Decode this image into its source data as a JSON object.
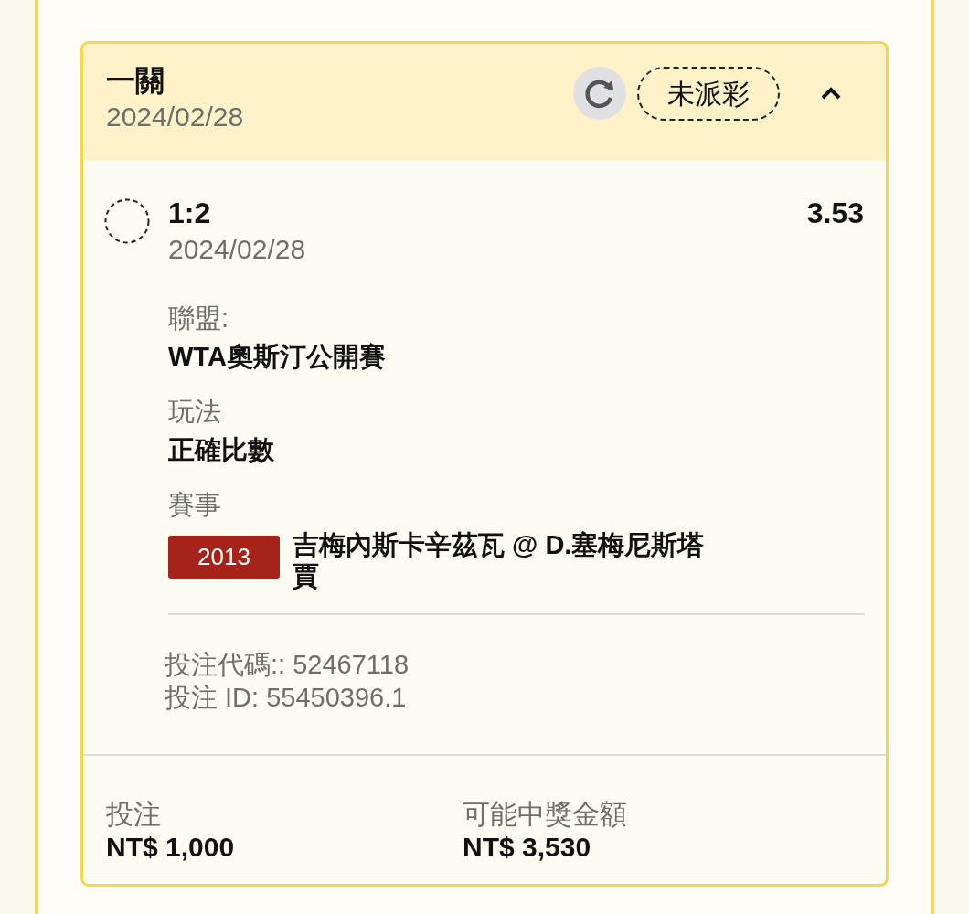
{
  "bet_card": {
    "title": "一關",
    "date": "2024/02/28",
    "status": "未派彩",
    "expanded": true,
    "selection": {
      "pick": "1:2",
      "date": "2024/02/28",
      "odds": "3.53",
      "details": [
        {
          "label": "聯盟:",
          "value": "WTA奧斯汀公開賽"
        },
        {
          "label": "玩法",
          "value": "正確比數"
        },
        {
          "label": "賽事",
          "tag": "2013",
          "value": "吉梅內斯卡辛茲瓦 @ D.塞梅尼斯塔賈"
        }
      ]
    },
    "bet_code": "投注代碼:: 52467118",
    "bet_id": "投注 ID: 55450396.1",
    "totals": [
      {
        "label": "投注",
        "value": "NT$ 1,000"
      },
      {
        "label": "可能中獎金額",
        "value": "NT$ 3,530"
      }
    ]
  }
}
